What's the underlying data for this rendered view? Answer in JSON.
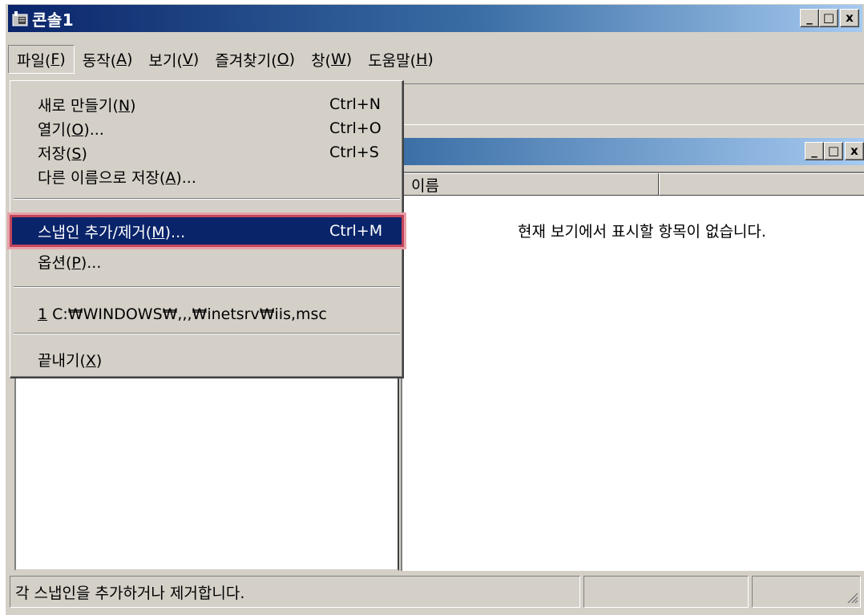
{
  "window": {
    "title": "콘솔1",
    "min_icon": "minimize-icon",
    "max_icon": "maximize-icon",
    "close_icon": "close-icon",
    "min_glyph": "_",
    "max_glyph": "□",
    "close_glyph": "x"
  },
  "menubar": {
    "items": [
      {
        "label": "파일(",
        "key": "F",
        "tail": ")"
      },
      {
        "label": "동작(",
        "key": "A",
        "tail": ")"
      },
      {
        "label": "보기(",
        "key": "V",
        "tail": ")"
      },
      {
        "label": "즐겨찾기(",
        "key": "O",
        "tail": ")"
      },
      {
        "label": "창(",
        "key": "W",
        "tail": ")"
      },
      {
        "label": "도움말(",
        "key": "H",
        "tail": ")"
      }
    ]
  },
  "file_menu": {
    "items": [
      {
        "label": "새로 만들기(",
        "key": "N",
        "tail": ")",
        "shortcut": "Ctrl+N"
      },
      {
        "label": "열기(",
        "key": "O",
        "tail": ")...",
        "shortcut": "Ctrl+O"
      },
      {
        "label": "저장(",
        "key": "S",
        "tail": ")",
        "shortcut": "Ctrl+S"
      },
      {
        "label": "다른 이름으로 저장(",
        "key": "A",
        "tail": ")...",
        "shortcut": ""
      },
      {
        "label": "스냅인 추가/제거(",
        "key": "M",
        "tail": ")...",
        "shortcut": "Ctrl+M"
      },
      {
        "label": "옵션(",
        "key": "P",
        "tail": ")...",
        "shortcut": ""
      },
      {
        "label": "",
        "key": "1",
        "tail": " C:₩WINDOWS₩,,,₩inetsrv₩iis,msc",
        "shortcut": ""
      },
      {
        "label": "끝내기(",
        "key": "X",
        "tail": ")",
        "shortcut": ""
      }
    ]
  },
  "list_view": {
    "columns": [
      "이름",
      ""
    ],
    "empty_message": "현재 보기에서 표시할 항목이 없습니다."
  },
  "statusbar": {
    "text": "각 스냅인을 추가하거나 제거합니다."
  },
  "colors": {
    "title_active": "#0a246a",
    "highlight_outline": "#c2455a",
    "face": "#d4d0c8"
  }
}
